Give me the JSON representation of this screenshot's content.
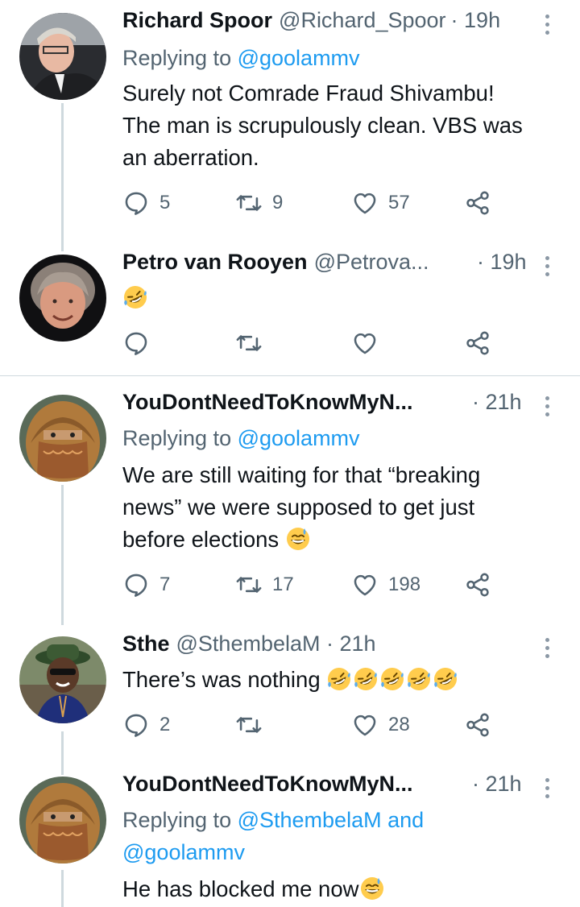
{
  "tweets": [
    {
      "name": "Richard Spoor",
      "handle": "@Richard_Spoor",
      "time": "· 19h",
      "replying_prefix": "Replying to ",
      "replying_handle": "@goolammv",
      "text_lines": [
        "Surely not Comrade Fraud Shivambu!",
        "The man is scrupulously clean. VBS was",
        "an aberration."
      ],
      "reply_count": "5",
      "retweet_count": "9",
      "like_count": "57"
    },
    {
      "name": "Petro van Rooyen",
      "handle": "@Petrova...",
      "time": "· 19h",
      "emoji": "rofl",
      "reply_count": "",
      "retweet_count": "",
      "like_count": ""
    },
    {
      "name": "YouDontNeedToKnowMyN...",
      "handle": "",
      "time": "· 21h",
      "replying_prefix": "Replying to ",
      "replying_handle": "@goolammv",
      "text_lines": [
        "We are still waiting for that “breaking",
        "news” we were supposed to get just",
        "before elections"
      ],
      "trailing_emoji": "grinning-face-with-sweat",
      "reply_count": "7",
      "retweet_count": "17",
      "like_count": "198"
    },
    {
      "name": "Sthe",
      "handle": "@SthembelaM · 21h",
      "text": "There’s was nothing",
      "emoji_repeat": 5,
      "emoji": "rofl",
      "reply_count": "2",
      "retweet_count": "",
      "like_count": "28"
    },
    {
      "name": "YouDontNeedToKnowMyN...",
      "handle": "",
      "time": "· 21h",
      "replying_prefix": "Replying to ",
      "replying_handle": "@SthembelaM",
      "replying_and": " and",
      "replying_handle_2": "@goolammv",
      "text": "He has blocked me now",
      "trailing_emoji": "grinning-face-with-sweat"
    }
  ],
  "colors": {
    "accent": "#1d9bf0",
    "secondary_text": "#536471",
    "primary_text": "#0f1419",
    "thread_line": "#cfd9de"
  },
  "icons": [
    "reply-icon",
    "retweet-icon",
    "like-icon",
    "share-icon",
    "more-icon"
  ]
}
